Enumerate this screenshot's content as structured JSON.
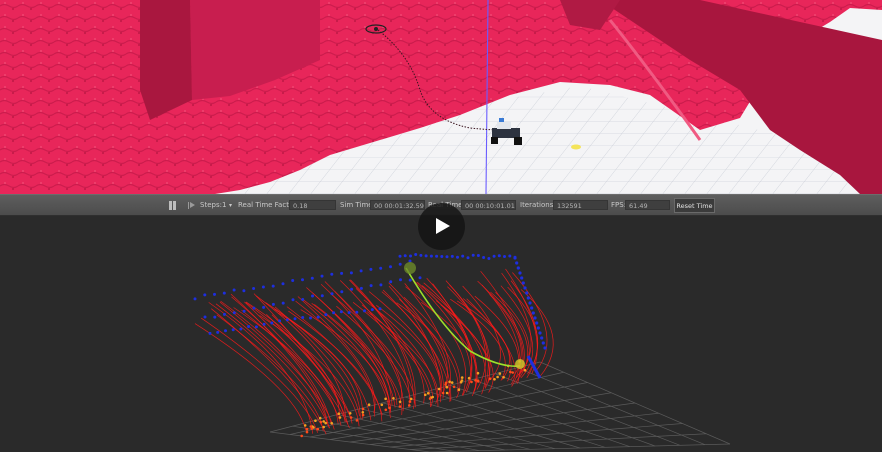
{
  "toolbar": {
    "steps_label": "Steps:",
    "steps_value": "1",
    "rtf_label": "Real Time Factor:",
    "rtf_value": "0.18",
    "sim_time_label": "Sim Time:",
    "sim_time_value": "00 00:01:32.590",
    "real_time_label": "Real Time:",
    "real_time_value": "00 00:10:01.015",
    "iterations_label": "Iterations:",
    "iterations_value": "132591",
    "fps_label": "FPS:",
    "fps_value": "61.49",
    "reset_label": "Reset Time"
  },
  "icons": {
    "pause": "pause-icon",
    "step": "step-forward-icon",
    "dropdown": "chevron-down-icon",
    "play": "play-icon"
  },
  "colors": {
    "terrain": "#e8265a",
    "terrain_dark": "#b81a47",
    "ground": "#f4f4f6",
    "rviz_bg": "#2a2a2a",
    "trajectory_red": "#ff1a1a",
    "waypoint_blue": "#1e2fe0",
    "frontier_orange": "#f5a020",
    "path_green": "#9de02a"
  }
}
